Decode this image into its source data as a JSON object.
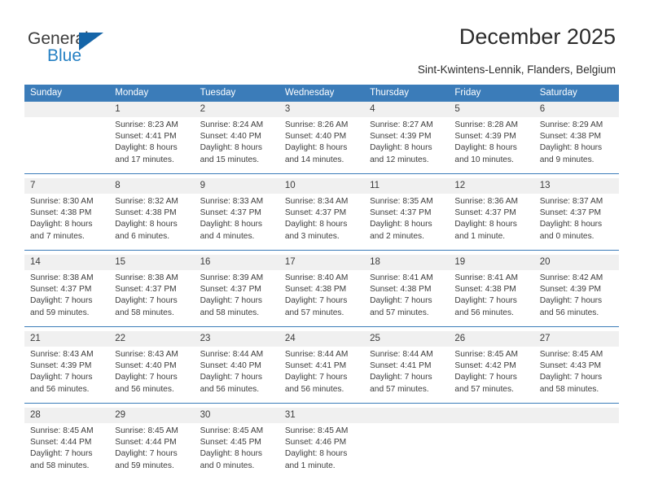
{
  "brand": {
    "name_top": "General",
    "name_bottom": "Blue",
    "triangle_icon": "triangle-icon",
    "accent_color": "#2580c3",
    "triangle_color": "#1565a8"
  },
  "header": {
    "title": "December 2025",
    "subtitle": "Sint-Kwintens-Lennik, Flanders, Belgium"
  },
  "calendar": {
    "header_bg": "#3b7cb9",
    "daynum_bg": "#f0f0f0",
    "weekday_labels": [
      "Sunday",
      "Monday",
      "Tuesday",
      "Wednesday",
      "Thursday",
      "Friday",
      "Saturday"
    ],
    "weeks": [
      [
        {
          "day": "",
          "sunrise": "",
          "sunset": "",
          "daylight1": "",
          "daylight2": ""
        },
        {
          "day": "1",
          "sunrise": "Sunrise: 8:23 AM",
          "sunset": "Sunset: 4:41 PM",
          "daylight1": "Daylight: 8 hours",
          "daylight2": "and 17 minutes."
        },
        {
          "day": "2",
          "sunrise": "Sunrise: 8:24 AM",
          "sunset": "Sunset: 4:40 PM",
          "daylight1": "Daylight: 8 hours",
          "daylight2": "and 15 minutes."
        },
        {
          "day": "3",
          "sunrise": "Sunrise: 8:26 AM",
          "sunset": "Sunset: 4:40 PM",
          "daylight1": "Daylight: 8 hours",
          "daylight2": "and 14 minutes."
        },
        {
          "day": "4",
          "sunrise": "Sunrise: 8:27 AM",
          "sunset": "Sunset: 4:39 PM",
          "daylight1": "Daylight: 8 hours",
          "daylight2": "and 12 minutes."
        },
        {
          "day": "5",
          "sunrise": "Sunrise: 8:28 AM",
          "sunset": "Sunset: 4:39 PM",
          "daylight1": "Daylight: 8 hours",
          "daylight2": "and 10 minutes."
        },
        {
          "day": "6",
          "sunrise": "Sunrise: 8:29 AM",
          "sunset": "Sunset: 4:38 PM",
          "daylight1": "Daylight: 8 hours",
          "daylight2": "and 9 minutes."
        }
      ],
      [
        {
          "day": "7",
          "sunrise": "Sunrise: 8:30 AM",
          "sunset": "Sunset: 4:38 PM",
          "daylight1": "Daylight: 8 hours",
          "daylight2": "and 7 minutes."
        },
        {
          "day": "8",
          "sunrise": "Sunrise: 8:32 AM",
          "sunset": "Sunset: 4:38 PM",
          "daylight1": "Daylight: 8 hours",
          "daylight2": "and 6 minutes."
        },
        {
          "day": "9",
          "sunrise": "Sunrise: 8:33 AM",
          "sunset": "Sunset: 4:37 PM",
          "daylight1": "Daylight: 8 hours",
          "daylight2": "and 4 minutes."
        },
        {
          "day": "10",
          "sunrise": "Sunrise: 8:34 AM",
          "sunset": "Sunset: 4:37 PM",
          "daylight1": "Daylight: 8 hours",
          "daylight2": "and 3 minutes."
        },
        {
          "day": "11",
          "sunrise": "Sunrise: 8:35 AM",
          "sunset": "Sunset: 4:37 PM",
          "daylight1": "Daylight: 8 hours",
          "daylight2": "and 2 minutes."
        },
        {
          "day": "12",
          "sunrise": "Sunrise: 8:36 AM",
          "sunset": "Sunset: 4:37 PM",
          "daylight1": "Daylight: 8 hours",
          "daylight2": "and 1 minute."
        },
        {
          "day": "13",
          "sunrise": "Sunrise: 8:37 AM",
          "sunset": "Sunset: 4:37 PM",
          "daylight1": "Daylight: 8 hours",
          "daylight2": "and 0 minutes."
        }
      ],
      [
        {
          "day": "14",
          "sunrise": "Sunrise: 8:38 AM",
          "sunset": "Sunset: 4:37 PM",
          "daylight1": "Daylight: 7 hours",
          "daylight2": "and 59 minutes."
        },
        {
          "day": "15",
          "sunrise": "Sunrise: 8:38 AM",
          "sunset": "Sunset: 4:37 PM",
          "daylight1": "Daylight: 7 hours",
          "daylight2": "and 58 minutes."
        },
        {
          "day": "16",
          "sunrise": "Sunrise: 8:39 AM",
          "sunset": "Sunset: 4:37 PM",
          "daylight1": "Daylight: 7 hours",
          "daylight2": "and 58 minutes."
        },
        {
          "day": "17",
          "sunrise": "Sunrise: 8:40 AM",
          "sunset": "Sunset: 4:38 PM",
          "daylight1": "Daylight: 7 hours",
          "daylight2": "and 57 minutes."
        },
        {
          "day": "18",
          "sunrise": "Sunrise: 8:41 AM",
          "sunset": "Sunset: 4:38 PM",
          "daylight1": "Daylight: 7 hours",
          "daylight2": "and 57 minutes."
        },
        {
          "day": "19",
          "sunrise": "Sunrise: 8:41 AM",
          "sunset": "Sunset: 4:38 PM",
          "daylight1": "Daylight: 7 hours",
          "daylight2": "and 56 minutes."
        },
        {
          "day": "20",
          "sunrise": "Sunrise: 8:42 AM",
          "sunset": "Sunset: 4:39 PM",
          "daylight1": "Daylight: 7 hours",
          "daylight2": "and 56 minutes."
        }
      ],
      [
        {
          "day": "21",
          "sunrise": "Sunrise: 8:43 AM",
          "sunset": "Sunset: 4:39 PM",
          "daylight1": "Daylight: 7 hours",
          "daylight2": "and 56 minutes."
        },
        {
          "day": "22",
          "sunrise": "Sunrise: 8:43 AM",
          "sunset": "Sunset: 4:40 PM",
          "daylight1": "Daylight: 7 hours",
          "daylight2": "and 56 minutes."
        },
        {
          "day": "23",
          "sunrise": "Sunrise: 8:44 AM",
          "sunset": "Sunset: 4:40 PM",
          "daylight1": "Daylight: 7 hours",
          "daylight2": "and 56 minutes."
        },
        {
          "day": "24",
          "sunrise": "Sunrise: 8:44 AM",
          "sunset": "Sunset: 4:41 PM",
          "daylight1": "Daylight: 7 hours",
          "daylight2": "and 56 minutes."
        },
        {
          "day": "25",
          "sunrise": "Sunrise: 8:44 AM",
          "sunset": "Sunset: 4:41 PM",
          "daylight1": "Daylight: 7 hours",
          "daylight2": "and 57 minutes."
        },
        {
          "day": "26",
          "sunrise": "Sunrise: 8:45 AM",
          "sunset": "Sunset: 4:42 PM",
          "daylight1": "Daylight: 7 hours",
          "daylight2": "and 57 minutes."
        },
        {
          "day": "27",
          "sunrise": "Sunrise: 8:45 AM",
          "sunset": "Sunset: 4:43 PM",
          "daylight1": "Daylight: 7 hours",
          "daylight2": "and 58 minutes."
        }
      ],
      [
        {
          "day": "28",
          "sunrise": "Sunrise: 8:45 AM",
          "sunset": "Sunset: 4:44 PM",
          "daylight1": "Daylight: 7 hours",
          "daylight2": "and 58 minutes."
        },
        {
          "day": "29",
          "sunrise": "Sunrise: 8:45 AM",
          "sunset": "Sunset: 4:44 PM",
          "daylight1": "Daylight: 7 hours",
          "daylight2": "and 59 minutes."
        },
        {
          "day": "30",
          "sunrise": "Sunrise: 8:45 AM",
          "sunset": "Sunset: 4:45 PM",
          "daylight1": "Daylight: 8 hours",
          "daylight2": "and 0 minutes."
        },
        {
          "day": "31",
          "sunrise": "Sunrise: 8:45 AM",
          "sunset": "Sunset: 4:46 PM",
          "daylight1": "Daylight: 8 hours",
          "daylight2": "and 1 minute."
        },
        {
          "day": "",
          "sunrise": "",
          "sunset": "",
          "daylight1": "",
          "daylight2": ""
        },
        {
          "day": "",
          "sunrise": "",
          "sunset": "",
          "daylight1": "",
          "daylight2": ""
        },
        {
          "day": "",
          "sunrise": "",
          "sunset": "",
          "daylight1": "",
          "daylight2": ""
        }
      ]
    ]
  }
}
